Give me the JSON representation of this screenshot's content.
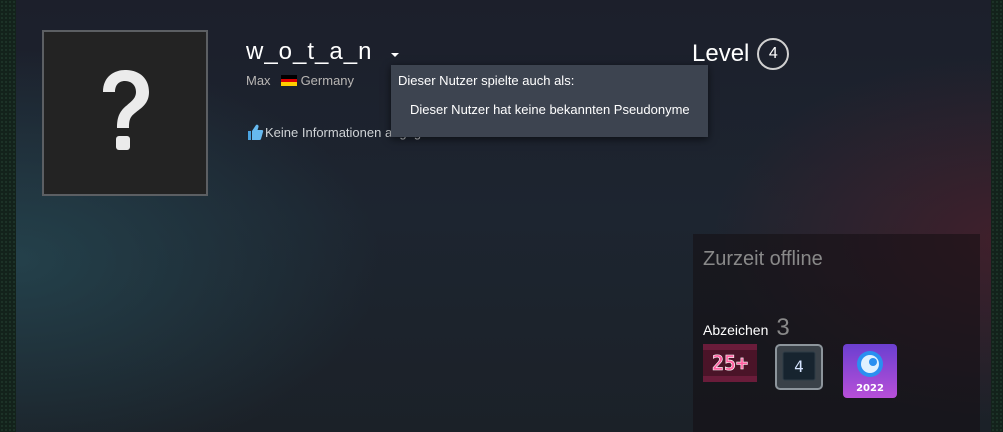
{
  "profile": {
    "persona_name": "w_o_t_a_n",
    "real_name": "Max",
    "country": "Germany",
    "summary": "Keine Informationen angegeben",
    "avatar_placeholder": "?"
  },
  "alias_popup": {
    "title": "Dieser Nutzer spielte auch als:",
    "empty_text": "Dieser Nutzer hat keine bekannten Pseudonyme"
  },
  "level": {
    "label": "Level",
    "value": "4"
  },
  "right_panel": {
    "status": "Zurzeit offline",
    "badges_label": "Abzeichen",
    "badges_count": "3",
    "badges": [
      {
        "name": "years-of-service-25-badge",
        "text": "25+"
      },
      {
        "name": "level-4-badge",
        "text": "4"
      },
      {
        "name": "steam-2022-badge",
        "text": "2022"
      }
    ]
  },
  "colors": {
    "flag_black": "#000000",
    "flag_red": "#dd0000",
    "flag_gold": "#ffce00",
    "popup_bg": "#3d4450",
    "badge_25_pink": "#d3357a",
    "steam_purple": "#8a46c8"
  },
  "icons": [
    "question-mark-icon",
    "caret-down-icon",
    "germany-flag-icon",
    "thumbs-up-icon"
  ]
}
